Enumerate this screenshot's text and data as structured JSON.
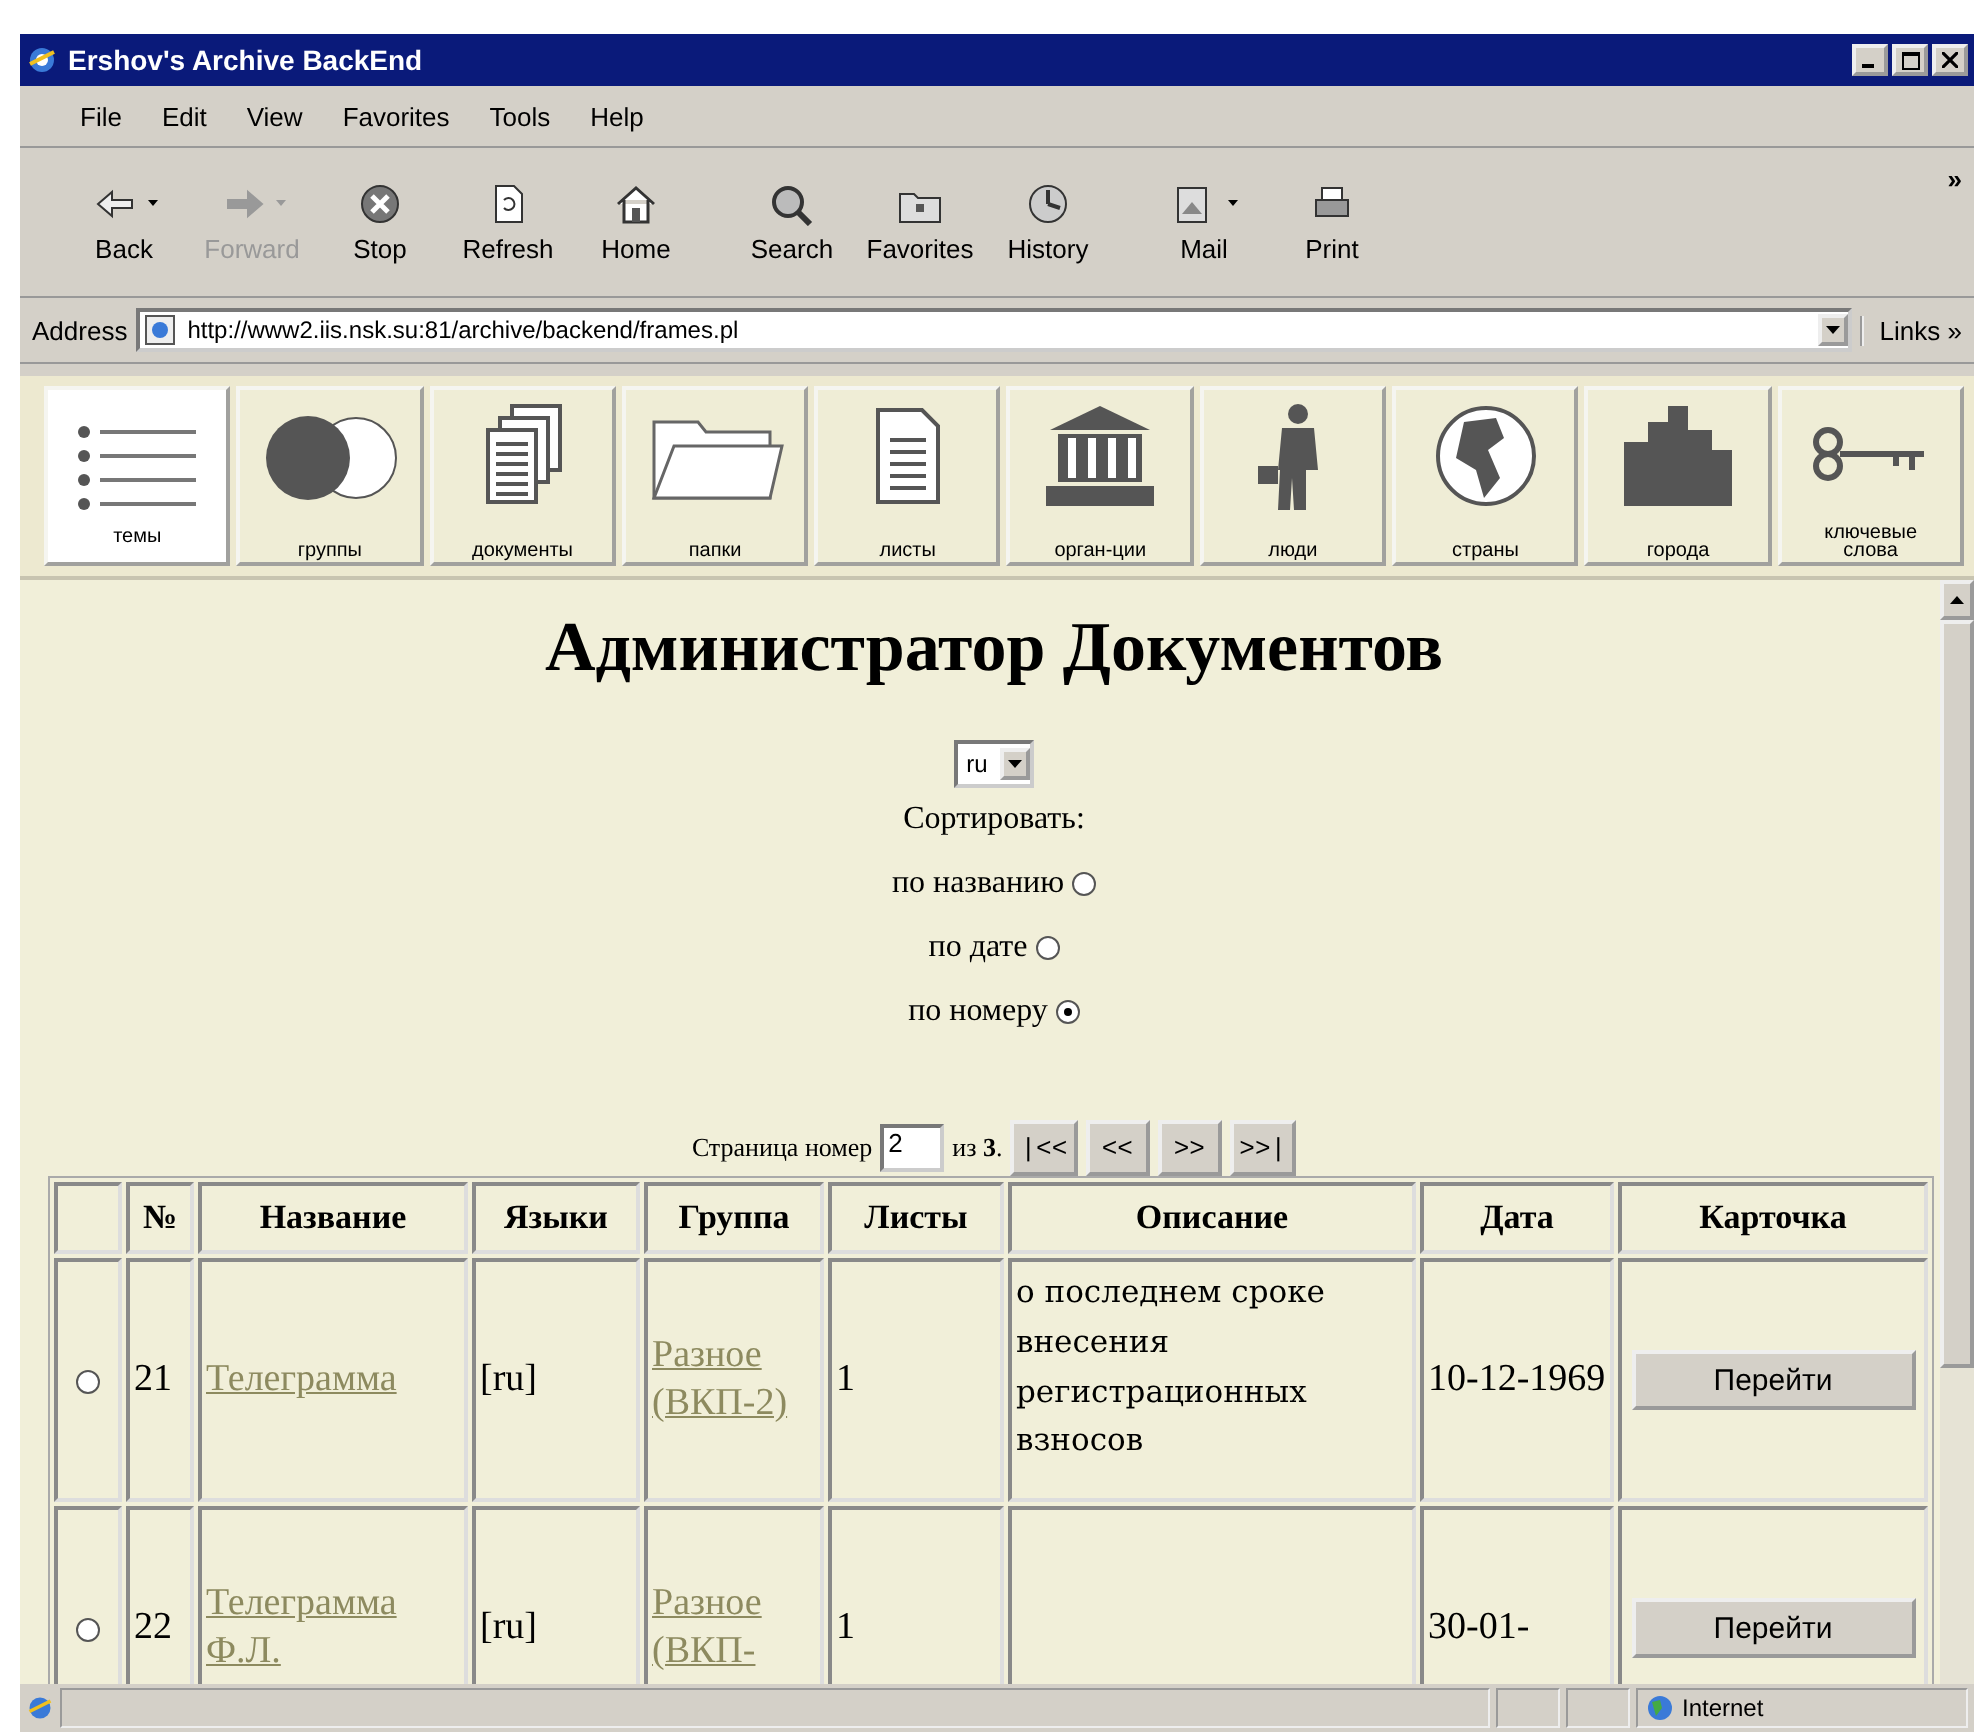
{
  "window": {
    "title": "Ershov's Archive BackEnd"
  },
  "menu": [
    "File",
    "Edit",
    "View",
    "Favorites",
    "Tools",
    "Help"
  ],
  "toolbar": [
    {
      "label": "Back",
      "disabled": false,
      "dropdown": true
    },
    {
      "label": "Forward",
      "disabled": true,
      "dropdown": true
    },
    {
      "label": "Stop",
      "disabled": false,
      "dropdown": false
    },
    {
      "label": "Refresh",
      "disabled": false,
      "dropdown": false
    },
    {
      "label": "Home",
      "disabled": false,
      "dropdown": false
    },
    {
      "label": "Search",
      "disabled": false,
      "dropdown": false
    },
    {
      "label": "Favorites",
      "disabled": false,
      "dropdown": false
    },
    {
      "label": "History",
      "disabled": false,
      "dropdown": false
    },
    {
      "label": "Mail",
      "disabled": false,
      "dropdown": true
    },
    {
      "label": "Print",
      "disabled": false,
      "dropdown": false
    }
  ],
  "toolbar_more": "»",
  "address": {
    "label": "Address",
    "value": "http://www2.iis.nsk.su:81/archive/backend/frames.pl"
  },
  "links": {
    "label": "Links",
    "more": "»"
  },
  "nav": [
    {
      "label": "темы",
      "selected": true
    },
    {
      "label": "группы",
      "selected": false
    },
    {
      "label": "документы",
      "selected": false
    },
    {
      "label": "папки",
      "selected": false
    },
    {
      "label": "листы",
      "selected": false
    },
    {
      "label": "орган-ции",
      "selected": false
    },
    {
      "label": "люди",
      "selected": false
    },
    {
      "label": "страны",
      "selected": false
    },
    {
      "label": "города",
      "selected": false
    },
    {
      "label": "ключевые слова",
      "selected": false
    }
  ],
  "heading": "Администратор Документов",
  "language_select": {
    "value": "ru"
  },
  "sort": {
    "label": "Сортировать:",
    "options": [
      {
        "label": "по названию",
        "selected": false
      },
      {
        "label": "по дате",
        "selected": false
      },
      {
        "label": "по номеру",
        "selected": true
      }
    ]
  },
  "pager": {
    "label": "Страница номер",
    "value": "2",
    "total": "из **3**.",
    "buttons": [
      "|<<",
      "<<",
      ">>",
      ">>|"
    ]
  },
  "table": {
    "columns": [
      "",
      "№",
      "Название",
      "Языки",
      "Группа",
      "Листы",
      "Описание",
      "Дата",
      "Карточка"
    ],
    "rows": [
      {
        "selected": false,
        "number": "21",
        "title": "Телеграмма",
        "languages": "[ru]",
        "group": "Разное (ВКП-2)",
        "sheets": "1",
        "description": "о последнем сроке внесения регистрационных взносов",
        "date": "10-12-1969",
        "action": "Перейти"
      },
      {
        "selected": false,
        "number": "22",
        "title": "Телеграмма Ф.Л.",
        "languages": "[ru]",
        "group": "Разное (ВКП-",
        "sheets": "1",
        "description": "",
        "date": "30-01-",
        "action": "Перейти"
      }
    ]
  },
  "status_bar": {
    "zone": "Internet"
  }
}
